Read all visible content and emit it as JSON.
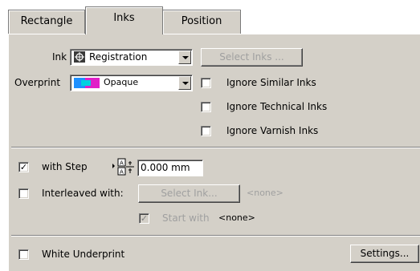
{
  "tabs": [
    {
      "label": "Rectangle",
      "active": false
    },
    {
      "label": "Inks",
      "active": true
    },
    {
      "label": "Position",
      "active": false
    }
  ],
  "ink": {
    "label": "Ink",
    "value": "Registration",
    "select_button": "Select Inks ..."
  },
  "overprint": {
    "label": "Overprint",
    "value": "Opaque"
  },
  "options": [
    {
      "label": "Ignore Similar Inks",
      "checked": false
    },
    {
      "label": "Ignore Technical Inks",
      "checked": false
    },
    {
      "label": "Ignore Varnish Inks",
      "checked": false
    }
  ],
  "step": {
    "checkbox_mark": "✓",
    "label": "with Step",
    "value": "0.000 mm"
  },
  "interleaved": {
    "label": "Interleaved with:",
    "select_button": "Select Ink...",
    "value": "<none>",
    "start_with_label": "Start with",
    "start_with_value": "<none>",
    "start_with_mark": "✓"
  },
  "white_underprint": {
    "label": "White Underprint",
    "settings_button": "Settings..."
  }
}
